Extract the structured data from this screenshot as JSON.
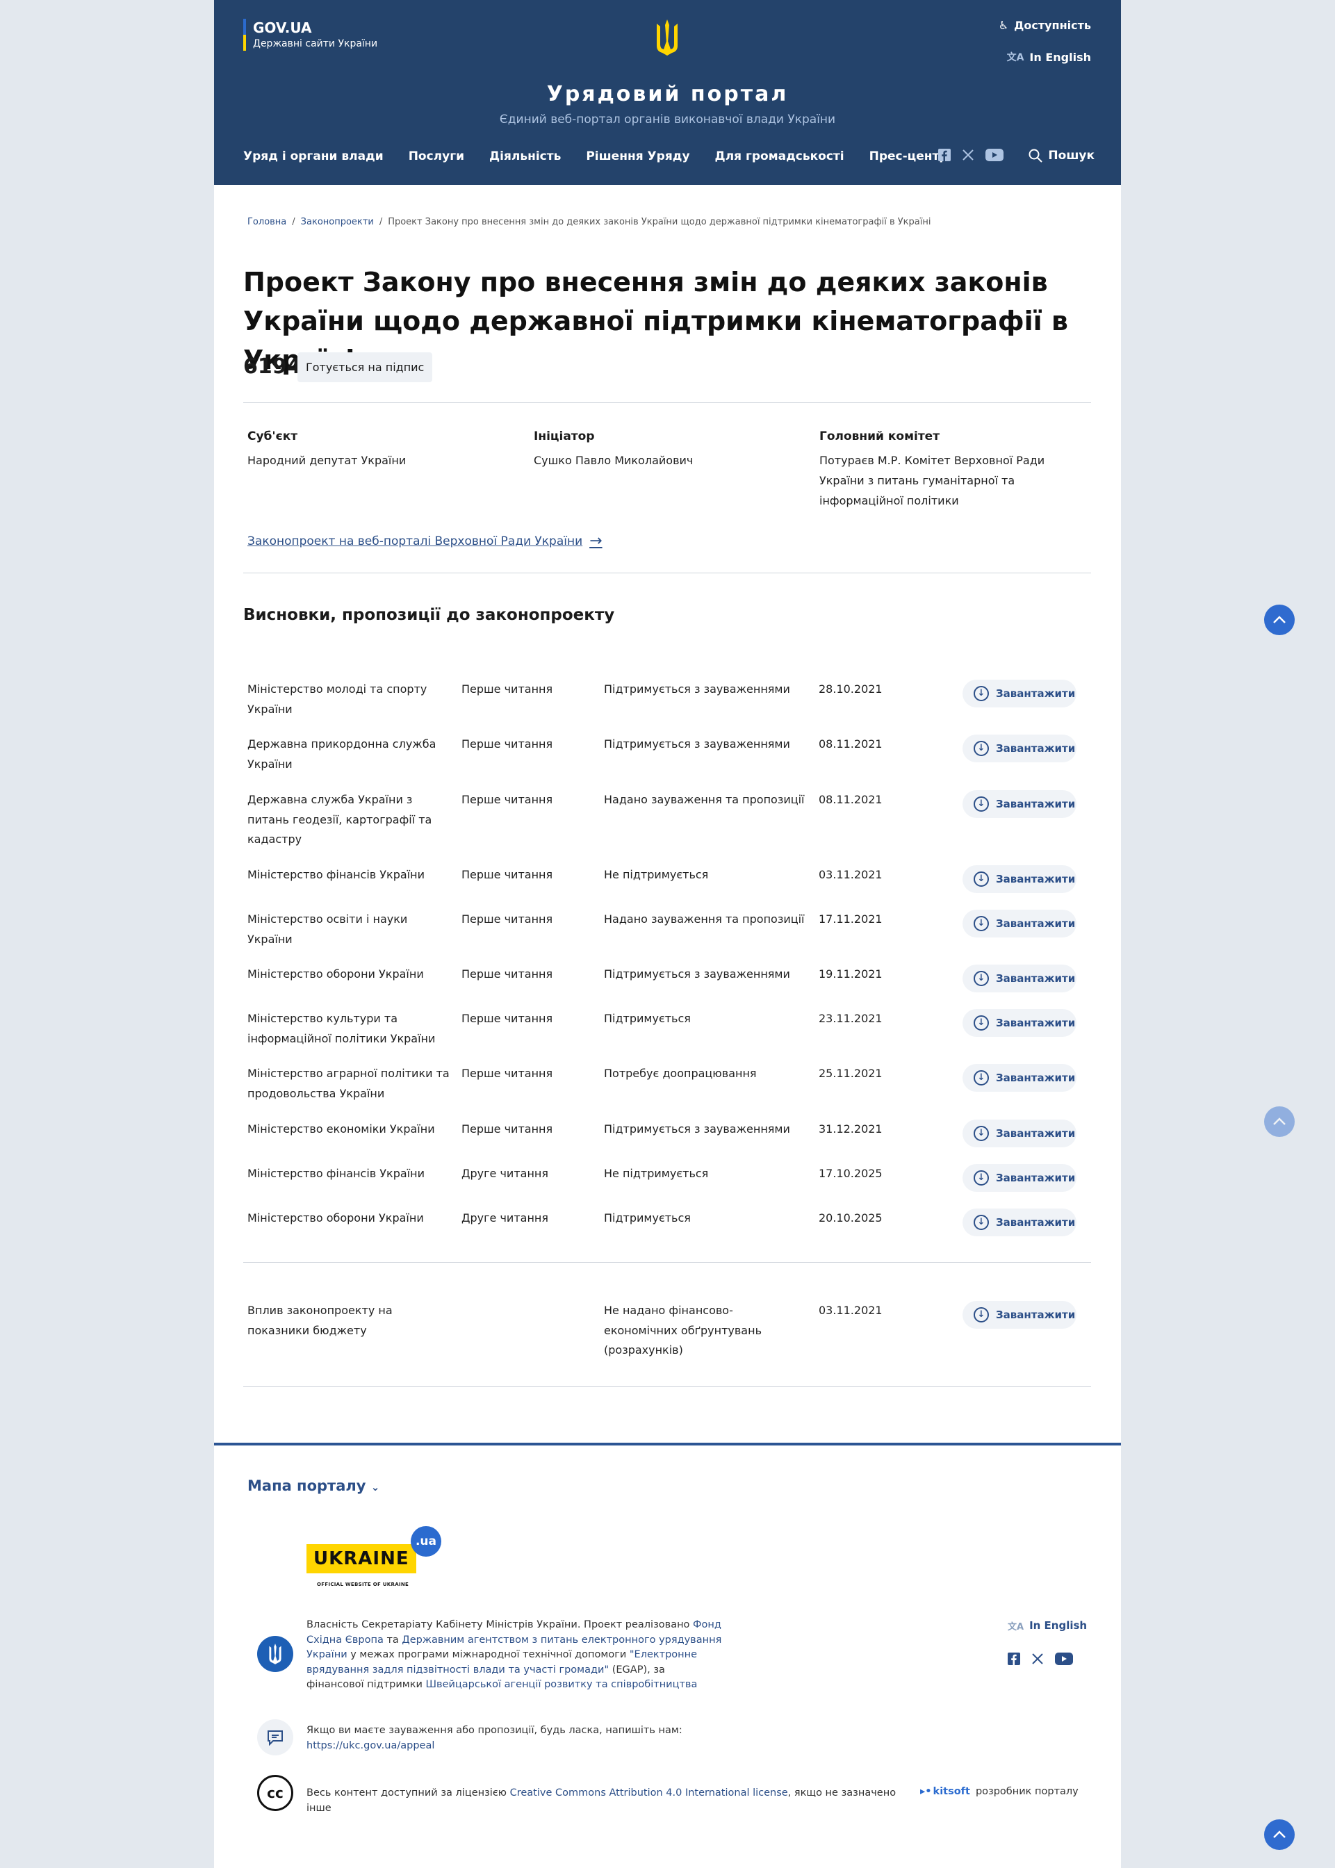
{
  "header": {
    "gov_title": "GOV.UA",
    "gov_subtitle": "Державні сайти України",
    "accessibility": "Доступність",
    "english": "In English",
    "portal_title": "Урядовий портал",
    "portal_subtitle": "Єдиний веб-портал органів виконавчої влади України",
    "nav": [
      "Уряд і органи влади",
      "Послуги",
      "Діяльність",
      "Рішення Уряду",
      "Для громадськості",
      "Прес-центр"
    ],
    "search": "Пошук"
  },
  "breadcrumb": {
    "home": "Головна",
    "section": "Законопроекти",
    "current": "Проект Закону про внесення змін до деяких законів України щодо державної підтримки кінематографії в Україні"
  },
  "bill": {
    "title": "Проект Закону про внесення змін до деяких законів України щодо державної підтримки кінематографії в Україні",
    "number": "6194",
    "status": "Готується на підпис",
    "subject_label": "Суб'єкт",
    "subject": "Народний депутат України",
    "initiator_label": "Ініціатор",
    "initiator": "Сушко Павло Миколайович",
    "committee_label": "Головний комітет",
    "committee": "Потураєв М.Р. Комітет Верховної Ради України з питань гуманітарної та інформаційної політики",
    "vr_link": "Законопроект на веб-порталі Верховної Ради України"
  },
  "conclusions": {
    "heading": "Висновки, пропозиції до законопроекту",
    "download_label": "Завантажити",
    "rows": [
      {
        "org": "Міністерство молоді та спорту України",
        "reading": "Перше читання",
        "position": "Підтримується з зауваженнями",
        "date": "28.10.2021"
      },
      {
        "org": "Державна прикордонна служба України",
        "reading": "Перше читання",
        "position": "Підтримується з зауваженнями",
        "date": "08.11.2021"
      },
      {
        "org": "Державна служба України з питань геодезії, картографії та кадастру",
        "reading": "Перше читання",
        "position": "Надано зауваження та пропозиції",
        "date": "08.11.2021"
      },
      {
        "org": "Міністерство фінансів України",
        "reading": "Перше читання",
        "position": "Не підтримується",
        "date": "03.11.2021"
      },
      {
        "org": "Міністерство освіти і науки України",
        "reading": "Перше читання",
        "position": "Надано зауваження та пропозиції",
        "date": "17.11.2021"
      },
      {
        "org": "Міністерство оборони України",
        "reading": "Перше читання",
        "position": "Підтримується з зауваженнями",
        "date": "19.11.2021"
      },
      {
        "org": "Міністерство культури та інформаційної політики України",
        "reading": "Перше читання",
        "position": "Підтримується",
        "date": "23.11.2021"
      },
      {
        "org": "Міністерство аграрної політики та продовольства України",
        "reading": "Перше читання",
        "position": "Потребує доопрацювання",
        "date": "25.11.2021"
      },
      {
        "org": "Міністерство економіки України",
        "reading": "Перше читання",
        "position": "Підтримується з зауваженнями",
        "date": "31.12.2021"
      },
      {
        "org": "Міністерство фінансів України",
        "reading": "Друге читання",
        "position": "Не підтримується",
        "date": "17.10.2025"
      },
      {
        "org": "Міністерство оборони України",
        "reading": "Друге читання",
        "position": "Підтримується",
        "date": "20.10.2025"
      }
    ],
    "budget": {
      "org": "Вплив законопроекту на показники бюджету",
      "reading": "",
      "position": "Не надано фінансово-економічних обґрунтувань (розрахунків)",
      "date": "03.11.2021"
    }
  },
  "footer": {
    "map": "Мапа порталу",
    "ua_logo": "UKRAINE",
    "ua_dot": ".ua",
    "ua_caption": "OFFICIAL WEBSITE OF UKRAINE",
    "ownership_1": "Власність Секретаріату Кабінету Міністрів України. Проект реалізовано ",
    "link_fund": "Фонд Східна Європа",
    "and": " та ",
    "link_agency": "Державним агентством з питань електронного урядування України",
    "ownership_2": " у межах програми міжнародної технічної допомоги ",
    "link_egap": "\"Електронне врядування задля підзвітності влади та участі громади\"",
    "ownership_3": " (EGAP), за фінансової підтримки ",
    "link_swiss": "Швейцарської агенції розвитку та співробітництва",
    "feedback": "Якщо ви маєте зауваження або пропозиції, будь ласка, напишіть нам:",
    "feedback_link": "https://ukc.gov.ua/appeal",
    "license_1": "Весь контент доступний за ліцензією ",
    "license_link": "Creative Commons Attribution 4.0 International license",
    "license_2": ", якщо не зазначено інше",
    "english": "In English",
    "kitsoft": "kitsoft",
    "developer": "розробник порталу"
  }
}
